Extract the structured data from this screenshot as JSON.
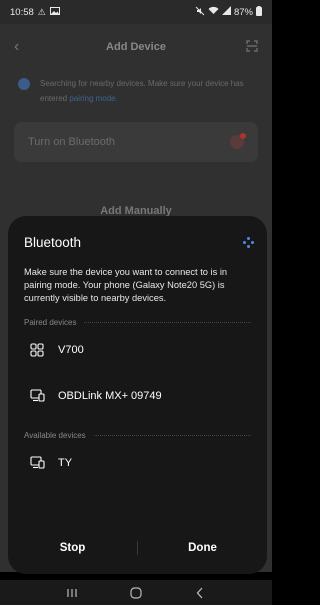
{
  "status_bar": {
    "time": "10:58",
    "battery": "87%",
    "icons": [
      "alert-icon",
      "photo-icon",
      "mute-icon",
      "wifi-icon",
      "signal-icon",
      "battery-icon"
    ]
  },
  "background_app": {
    "title": "Add Device",
    "searching_text": "Searching for nearby devices. Make sure your device has entered",
    "searching_link": "pairing mode.",
    "bluetooth_card_label": "Turn on Bluetooth",
    "add_manually": "Add Manually"
  },
  "sheet": {
    "title": "Bluetooth",
    "description": "Make sure the device you want to connect to is in pairing mode. Your phone (Galaxy Note20 5G) is currently visible to nearby devices.",
    "paired_label": "Paired devices",
    "paired_devices": [
      {
        "name": "V700",
        "icon": "grid-device-icon"
      },
      {
        "name": "OBDLink MX+ 09749",
        "icon": "computer-device-icon"
      }
    ],
    "available_label": "Available devices",
    "available_devices": [
      {
        "name": "TY",
        "icon": "computer-device-icon"
      }
    ],
    "stop_label": "Stop",
    "done_label": "Done"
  },
  "colors": {
    "sheet_bg": "#171717",
    "accent": "#4a8be8",
    "dim_bg": "#303030"
  }
}
